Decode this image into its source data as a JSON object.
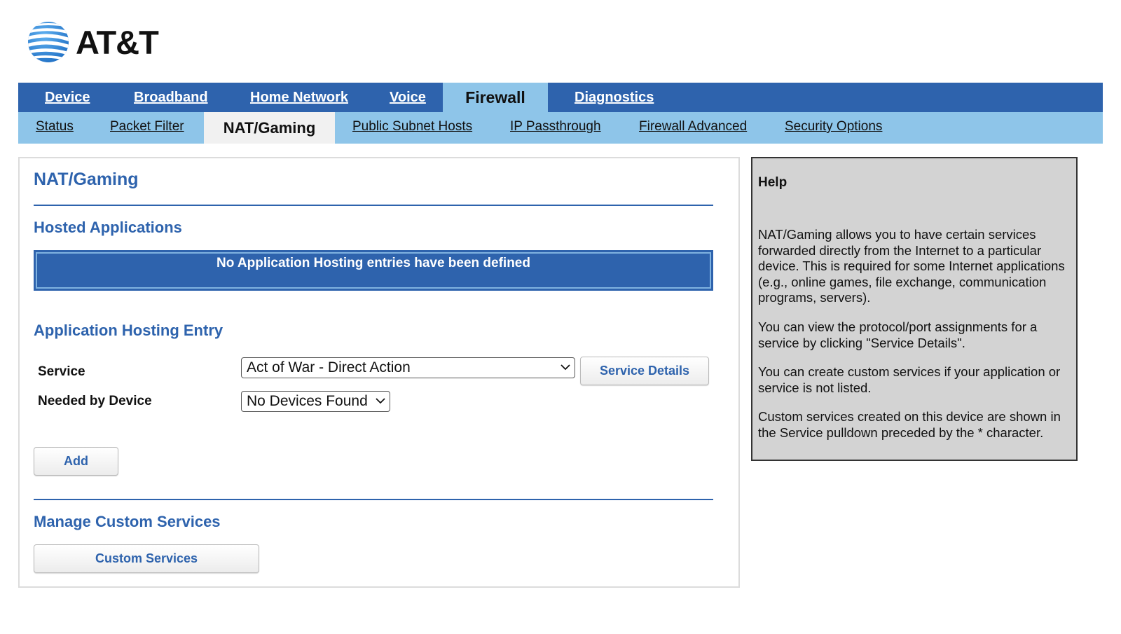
{
  "brand": {
    "name": "AT&T",
    "logo_icon": "att-globe-icon",
    "colors": {
      "primary_blue": "#2e63ad",
      "light_blue": "#8ec5e9",
      "globe_blue": "#3a8ee0"
    }
  },
  "nav": {
    "primary": [
      {
        "label": "Device",
        "active": false
      },
      {
        "label": "Broadband",
        "active": false
      },
      {
        "label": "Home Network",
        "active": false
      },
      {
        "label": "Voice",
        "active": false
      },
      {
        "label": "Firewall",
        "active": true
      },
      {
        "label": "Diagnostics",
        "active": false
      }
    ],
    "secondary": [
      {
        "label": "Status",
        "active": false
      },
      {
        "label": "Packet Filter",
        "active": false
      },
      {
        "label": "NAT/Gaming",
        "active": true
      },
      {
        "label": "Public Subnet Hosts",
        "active": false
      },
      {
        "label": "IP Passthrough",
        "active": false
      },
      {
        "label": "Firewall Advanced",
        "active": false
      },
      {
        "label": "Security Options",
        "active": false
      }
    ]
  },
  "main": {
    "title": "NAT/Gaming",
    "hosted_applications": {
      "heading": "Hosted Applications",
      "empty_message": "No Application Hosting entries have been defined"
    },
    "entry": {
      "heading": "Application Hosting Entry",
      "service_label": "Service",
      "service_value": "Act of War - Direct Action",
      "service_details_button": "Service Details",
      "device_label": "Needed by Device",
      "device_value": "No Devices Found",
      "add_button": "Add"
    },
    "custom": {
      "heading": "Manage Custom Services",
      "button": "Custom Services"
    }
  },
  "help": {
    "title": "Help",
    "paragraphs": [
      "NAT/Gaming allows you to have certain services forwarded directly from the Internet to a particular device. This is required for some Internet applications (e.g., online games, file exchange, communication programs, servers).",
      "You can view the protocol/port assignments for a service by clicking \"Service Details\".",
      "You can create custom services if your application or service is not listed.",
      "Custom services created on this device are shown in the Service pulldown preceded by the * character."
    ]
  }
}
